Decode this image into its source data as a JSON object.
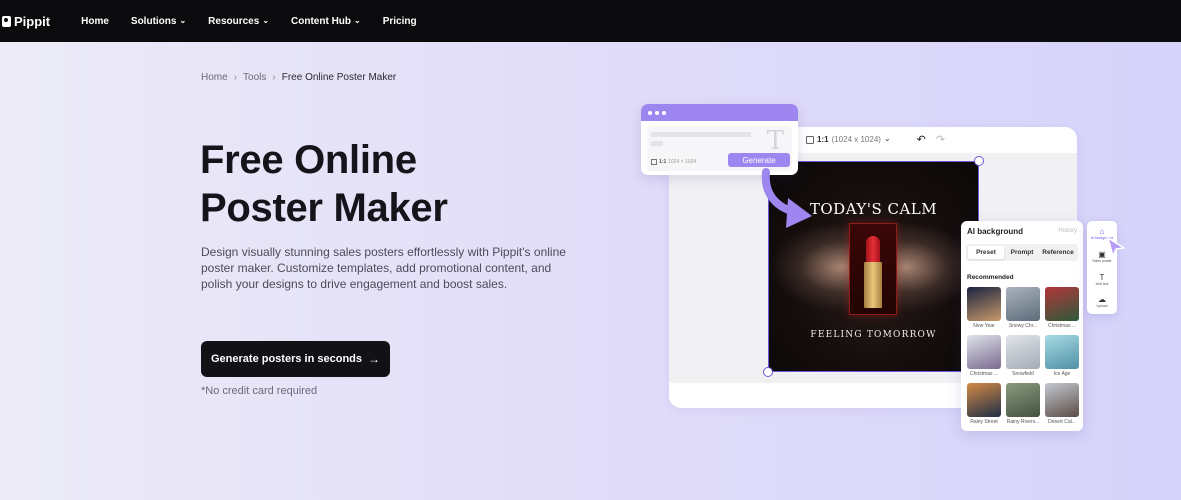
{
  "nav": {
    "logo": "Pippit",
    "items": [
      {
        "label": "Home",
        "dropdown": false
      },
      {
        "label": "Solutions",
        "dropdown": true
      },
      {
        "label": "Resources",
        "dropdown": true
      },
      {
        "label": "Content Hub",
        "dropdown": true
      },
      {
        "label": "Pricing",
        "dropdown": false
      }
    ]
  },
  "breadcrumb": {
    "items": [
      "Home",
      "Tools",
      "Free Online Poster Maker"
    ],
    "separator": "›"
  },
  "hero": {
    "title_line1": "Free Online",
    "title_line2": "Poster Maker",
    "description": "Design visually stunning sales posters effortlessly with Pippit's online poster maker. Customize templates, add promotional content, and polish your designs to drive engagement and boost sales.",
    "cta_label": "Generate posters in seconds",
    "cta_arrow": "→",
    "note": "*No credit card required"
  },
  "editor": {
    "ratio": "1:1",
    "size": "(1024 x 1024)",
    "undo_icon": "↶",
    "redo_icon": "↷"
  },
  "prompt_card": {
    "placeholder_glyph": "T",
    "ratio": "1:1",
    "size": "1024 × 1024",
    "generate_label": "Generate"
  },
  "poster": {
    "title": "TODAY'S CALM",
    "subtitle": "FEELING TOMORROW"
  },
  "ai_panel": {
    "title": "AI background",
    "history": "History",
    "tabs": [
      "Preset",
      "Prompt",
      "Reference"
    ],
    "active_tab": "Preset",
    "section": "Recommended",
    "thumbnails": [
      {
        "label": "New Year",
        "color1": "#1b2240",
        "color2": "#c79b6a"
      },
      {
        "label": "Snowy Chr...",
        "color1": "#a9b3bf",
        "color2": "#5e6b79"
      },
      {
        "label": "Christmas ...",
        "color1": "#b3363a",
        "color2": "#2c5a3a"
      },
      {
        "label": "Christmas ...",
        "color1": "#dfe3ea",
        "color2": "#7a6b8f"
      },
      {
        "label": "Snowfield",
        "color1": "#e1e5eb",
        "color2": "#a4abb5"
      },
      {
        "label": "Ice Age",
        "color1": "#a8dbe4",
        "color2": "#4f90a6"
      },
      {
        "label": "Rainy Street",
        "color1": "#d48a45",
        "color2": "#1e2e48"
      },
      {
        "label": "Rainy Rivers...",
        "color1": "#8a9a80",
        "color2": "#44523e"
      },
      {
        "label": "Desert Cal...",
        "color1": "#c4c9d2",
        "color2": "#5c4c44"
      }
    ]
  },
  "side_tools": [
    {
      "icon": "⌂",
      "label": "AI background",
      "active": true
    },
    {
      "icon": "▣",
      "label": "Sales poster",
      "active": false
    },
    {
      "icon": "T",
      "label": "Add text",
      "active": false
    },
    {
      "icon": "☁",
      "label": "Upload",
      "active": false
    }
  ],
  "colors": {
    "accent": "#9e86f0",
    "selection": "#6b59d8",
    "nav_bg": "#0b0b0d",
    "cta_bg": "#111116"
  }
}
